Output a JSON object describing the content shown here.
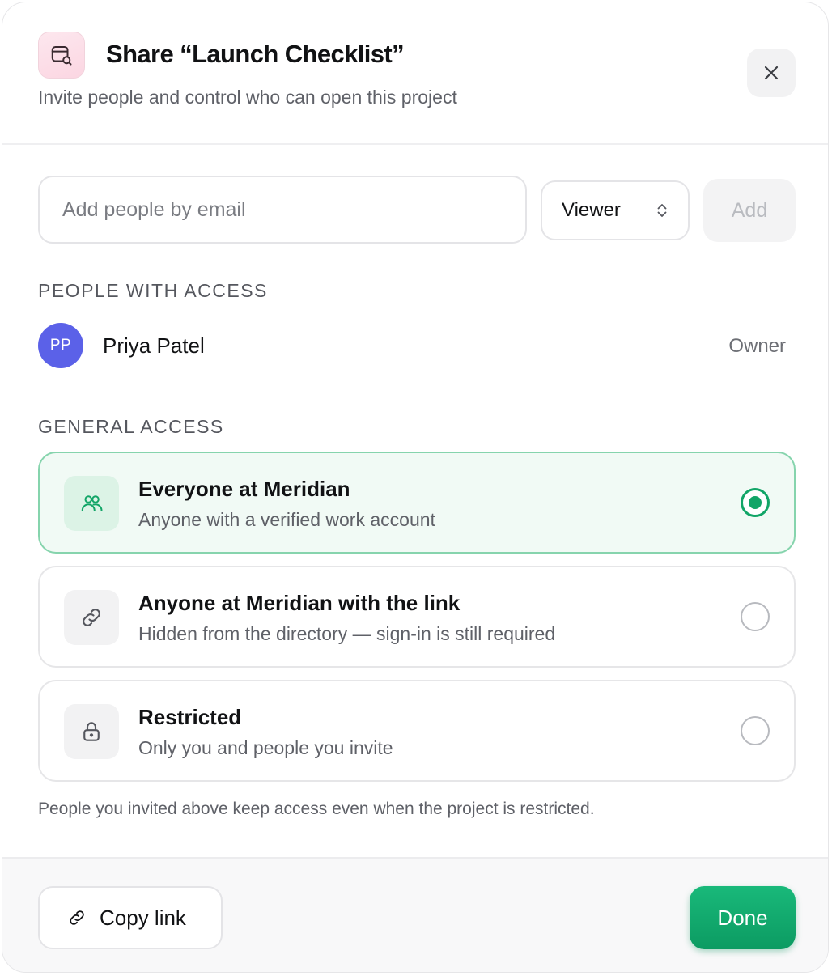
{
  "dialog": {
    "title": "Share “Launch Checklist”",
    "subtitle": "Invite people and control who can open this project",
    "app_icon": "project-share-icon",
    "close_icon": "close-icon"
  },
  "invite": {
    "email_placeholder": "Add people by email",
    "email_value": "",
    "role_value": "Viewer",
    "add_label": "Add",
    "add_disabled": true
  },
  "people": {
    "section_label": "PEOPLE WITH ACCESS",
    "items": [
      {
        "initials": "PP",
        "name": "Priya Patel",
        "role": "Owner",
        "avatar_color": "#5b61e8"
      }
    ]
  },
  "general_access": {
    "section_label": "GENERAL ACCESS",
    "selected": "everyone",
    "options": [
      {
        "id": "everyone",
        "icon": "people-icon",
        "title": "Everyone at Meridian",
        "description": "Anyone with a verified work account",
        "selected": true
      },
      {
        "id": "link",
        "icon": "link-icon",
        "title": "Anyone at Meridian with the link",
        "description": "Hidden from the directory — sign-in is still required",
        "selected": false
      },
      {
        "id": "restricted",
        "icon": "lock-icon",
        "title": "Restricted",
        "description": "Only you and people you invite",
        "selected": false
      }
    ],
    "note": "People you invited above keep access even when the project is restricted."
  },
  "footer": {
    "copy_link_label": "Copy link",
    "copy_link_icon": "link-icon",
    "done_label": "Done"
  },
  "colors": {
    "accent": "#12a567",
    "selected_border": "#86d4ad",
    "selected_bg": "#f1faf5",
    "avatar": "#5b61e8"
  }
}
